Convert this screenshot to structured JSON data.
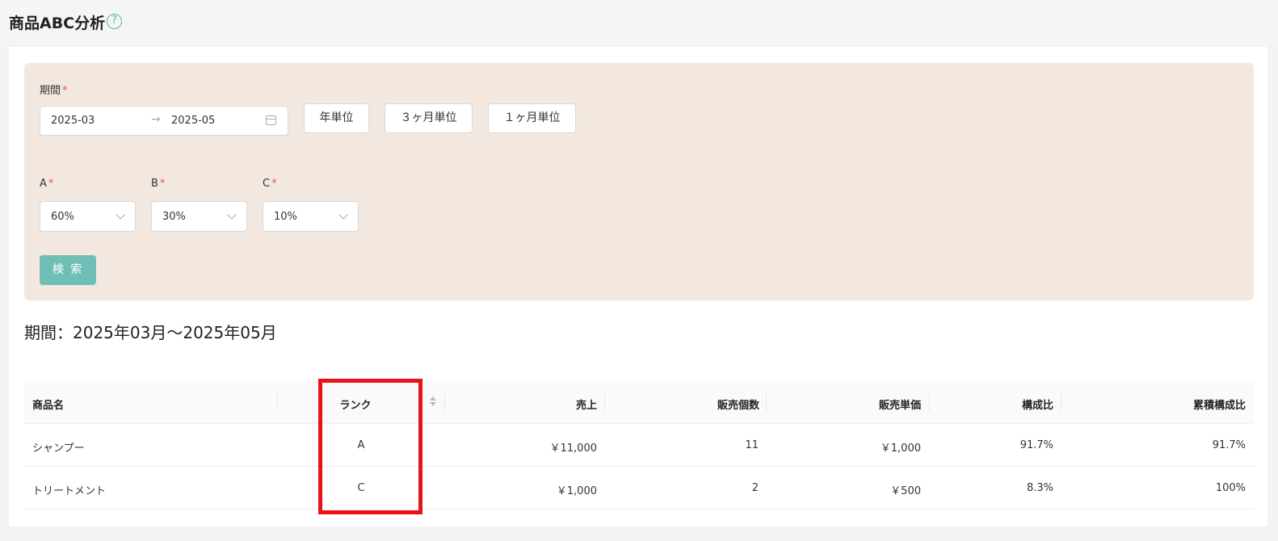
{
  "page": {
    "title": "商品ABC分析"
  },
  "filters": {
    "period_label": "期間",
    "required_mark": "*",
    "date_start": "2025-03",
    "date_arrow": "→",
    "date_end": "2025-05",
    "unit_buttons": [
      "年単位",
      "３ヶ月単位",
      "１ヶ月単位"
    ],
    "a_label": "A",
    "a_value": "60%",
    "b_label": "B",
    "b_value": "30%",
    "c_label": "C",
    "c_value": "10%",
    "search_label": "検 索"
  },
  "result": {
    "period_heading": "期間：2025年03月～2025年05月"
  },
  "table": {
    "columns": [
      "商品名",
      "ランク",
      "売上",
      "販売個数",
      "販売単価",
      "構成比",
      "累積構成比"
    ],
    "rows": [
      {
        "name": "シャンプー",
        "rank": "A",
        "sales": "￥11,000",
        "qty": "11",
        "unit_price": "￥1,000",
        "ratio": "91.7%",
        "cum_ratio": "91.7%"
      },
      {
        "name": "トリートメント",
        "rank": "C",
        "sales": "￥1,000",
        "qty": "2",
        "unit_price": "￥500",
        "ratio": "8.3%",
        "cum_ratio": "100%"
      }
    ]
  },
  "colors": {
    "accent": "#6fbfb6",
    "filter_bg": "#f2e8e0",
    "highlight": "#e8121a"
  }
}
